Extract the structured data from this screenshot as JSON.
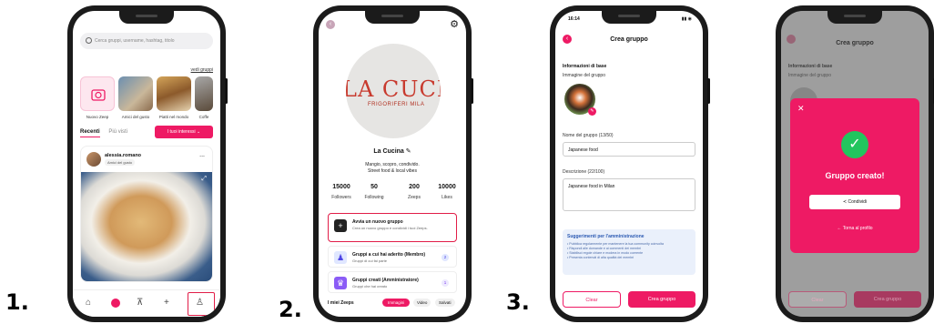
{
  "steps": [
    "1.",
    "2.",
    "3."
  ],
  "phone1": {
    "search_placeholder": "Cerca gruppi, username, hashtag, titolo",
    "vedi_gruppi": "vedi gruppi",
    "stories": [
      {
        "label": "Nuovo Zeep"
      },
      {
        "label": "Amici del gusto"
      },
      {
        "label": "Piatti nel mondo"
      },
      {
        "label": "Coffe"
      }
    ],
    "tabs": [
      "Recenti",
      "Più visti"
    ],
    "interessi_button": "I tuoi interessi",
    "post_user": "alessia.romano",
    "post_group": "Amici del gusto",
    "post_menu": "...",
    "nav_icons": [
      "home-icon",
      "zeep-icon",
      "cart-icon",
      "plus-icon",
      "profile-icon"
    ]
  },
  "phone2": {
    "logo_text": "LA CUCIN",
    "logo_sub": "FRIGORIFERI MILA",
    "name": "La Cucina",
    "bio_line1": "Mangio, scopro, condivido.",
    "bio_line2": "Street food & local vibes",
    "stats": [
      {
        "value": "15000",
        "label": "Followers"
      },
      {
        "value": "50",
        "label": "Following"
      },
      {
        "value": "200",
        "label": "Zeeps"
      },
      {
        "value": "10000",
        "label": "Likes"
      }
    ],
    "card_new_title": "Avvia un nuovo gruppo",
    "card_new_sub": "Crea un nuovo gruppo e condividi i tuoi Zeeps.",
    "card_member_title": "Gruppi a cui hai aderito (Membro)",
    "card_member_sub": "Gruppi di cui fai parte",
    "card_member_badge": "2",
    "card_admin_title": "Gruppi creati (Amministratore)",
    "card_admin_sub": "Gruppi che hai creato",
    "card_admin_badge": "1",
    "bottom_label": "I miei Zeeps",
    "bottom_tabs": [
      "Immagini",
      "Video",
      "Salvati"
    ]
  },
  "phone3": {
    "status_time": "16:14",
    "title": "Crea gruppo",
    "section": "Informazioni di base",
    "image_label": "Immagine del gruppo",
    "name_label": "Nome del gruppo (13/50)",
    "name_value": "Japanese food",
    "desc_label": "Descrizione (22/100)",
    "desc_value": "Japanese food in Milan",
    "suggest_title": "Suggerimenti per l'amministrazione",
    "suggest_items": [
      "Pubblica regolarmente per mantenere la tua community coinvolta",
      "Rispondi alle domande e ai commenti dei membri",
      "Stabilisci regole chiare e modera in modo coerente",
      "Presenta contenuti di alta qualità dei membri"
    ],
    "clear_button": "Clear",
    "create_button": "Crea gruppo"
  },
  "phone4": {
    "title": "Crea gruppo",
    "section": "Informazioni di base",
    "image_label": "Immagine del gruppo",
    "done": "Gruppo creato!",
    "share_button": "Condividi",
    "back_link": "Torna al profilo",
    "clear_button": "Clear",
    "create_button": "Crea gruppo"
  },
  "colors": {
    "accent": "#ee1a64",
    "success": "#22c55e",
    "info_bg": "#eaf0fb"
  }
}
